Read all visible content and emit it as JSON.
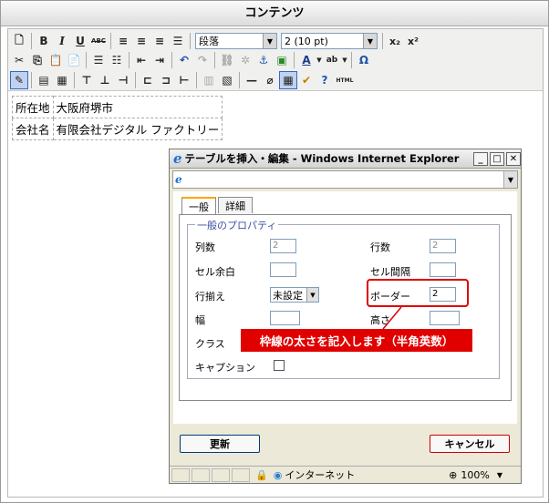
{
  "window": {
    "title": "コンテンツ"
  },
  "toolbar": {
    "format_select": "段落",
    "size_select": "2 (10 pt)",
    "abc_label": "ABC",
    "html_label": "HTML"
  },
  "content_table": [
    [
      "所在地",
      "大阪府堺市"
    ],
    [
      "会社名",
      "有限会社デジタル ファクトリー"
    ]
  ],
  "dialog": {
    "title": "テーブルを挿入・編集 - Windows Internet Explorer",
    "tabs": [
      "一般",
      "詳細"
    ],
    "legend": "一般のプロパティ",
    "fields": {
      "columns_label": "列数",
      "columns_value": "2",
      "rows_label": "行数",
      "rows_value": "2",
      "cellpadding_label": "セル余白",
      "cellspacing_label": "セル間隔",
      "align_label": "行揃え",
      "align_value": "未設定",
      "border_label": "ボーダー",
      "border_value": "2",
      "width_label": "幅",
      "height_label": "高さ",
      "class_label": "クラス",
      "caption_label": "キャプション"
    },
    "callout": "枠線の太さを記入します（半角英数）",
    "update_button": "更新",
    "cancel_button": "キャンセル",
    "status": {
      "zone": "インターネット",
      "zoom": "100%"
    }
  },
  "colors": {
    "highlight": "#e00000",
    "accent": "#316ac5"
  }
}
